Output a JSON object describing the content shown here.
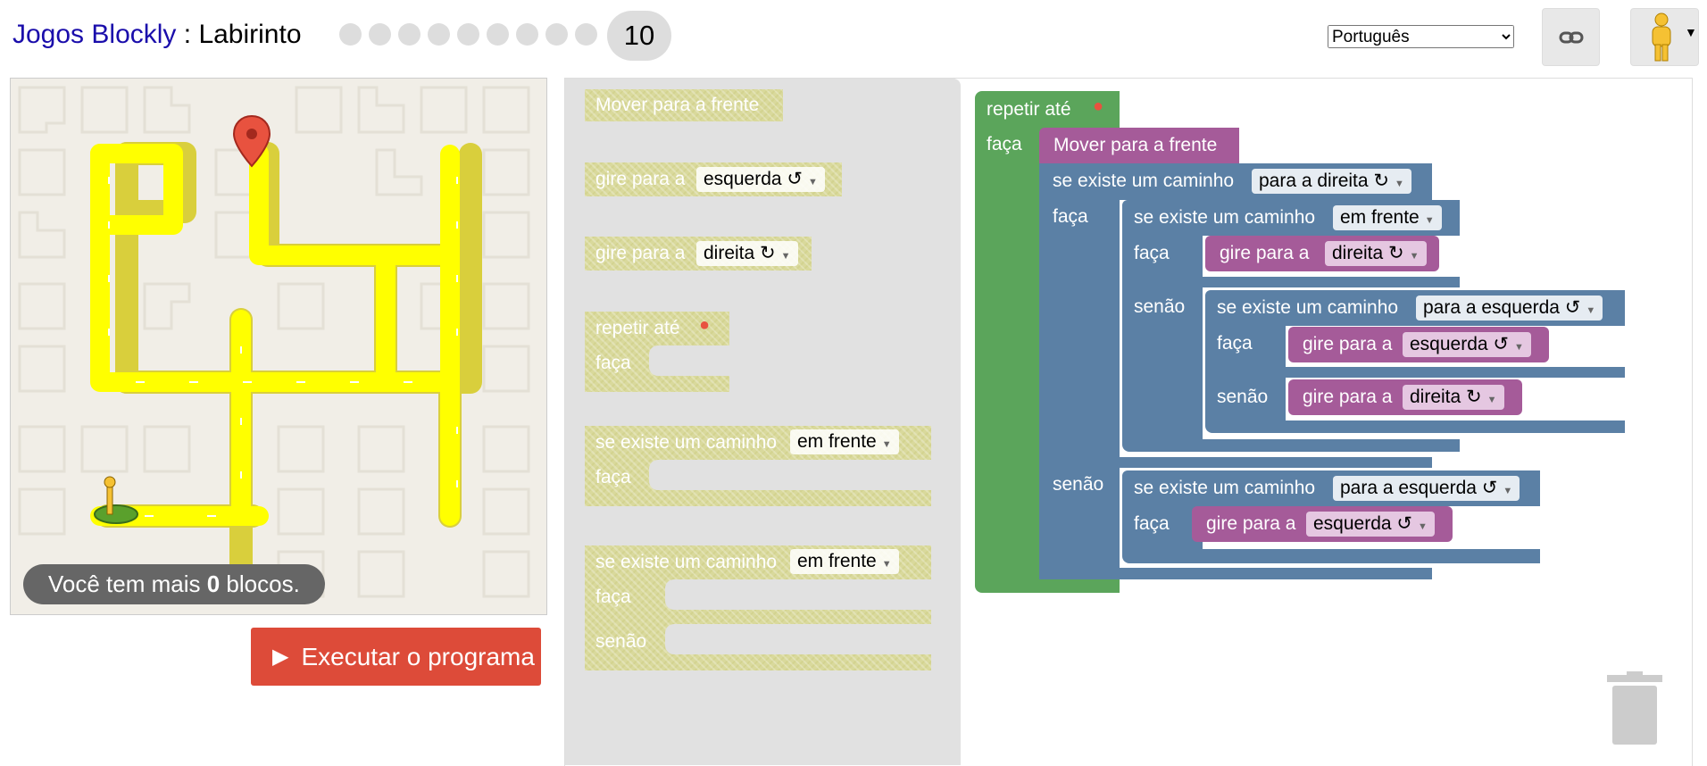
{
  "header": {
    "app_name": "Jogos Blockly",
    "separator": " : ",
    "game_name": "Labirinto",
    "current_level": "10",
    "language": "Português",
    "language_options": [
      "Português"
    ]
  },
  "maze": {
    "capacity_prefix": "Você tem mais ",
    "capacity_count": "0",
    "capacity_suffix": " blocos.",
    "run_button": "Executar o programa"
  },
  "flyout": {
    "move_forward": "Mover para a frente",
    "turn": "gire para a",
    "left": "esquerda ↺",
    "right": "direita ↻",
    "repeat_until": "repetir até",
    "do": "faça",
    "if_path": "se existe um caminho",
    "ahead": "em frente",
    "else": "senão"
  },
  "program": {
    "repeat_until": "repetir até",
    "do": "faça",
    "move_forward": "Mover para a frente",
    "if_path": "se existe um caminho",
    "turn": "gire para a",
    "else": "senão",
    "to_the_right": "para a direita ↻",
    "to_the_left": "para a esquerda ↺",
    "ahead": "em frente",
    "left": "esquerda ↺",
    "right": "direita ↻"
  },
  "colors": {
    "loop": "#5ba55b",
    "logic": "#5b80a5",
    "movement": "#a55b99",
    "run_button": "#dd4b39",
    "path": "#ffff00"
  }
}
